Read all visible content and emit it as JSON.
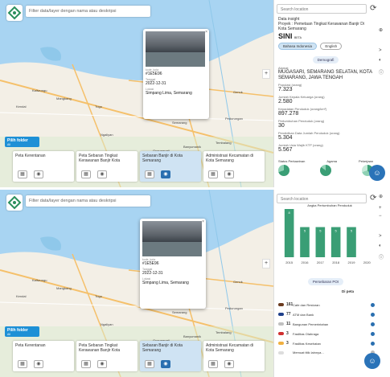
{
  "filter_placeholder": "Filter data/layer dengan nama atau deskripsi",
  "popup": {
    "code_label": "kode_kota",
    "code": "#1E5E96",
    "date_label": "Tanggal",
    "date": "2022-12-31",
    "location_label": "Lokasi",
    "location": "Simpang Lima, Semarang",
    "close": "×"
  },
  "folder": {
    "title": "Pilih folder",
    "sub": "All"
  },
  "layers": [
    {
      "name": "Peta Kerentanan"
    },
    {
      "name": "Peta Sebaran Tingkat Kerawanan Banjir Kota"
    },
    {
      "name": "Sebaran Banjir di Kota Semarang"
    },
    {
      "name": "Administrasi Kecamatan di Kota Semarang"
    }
  ],
  "map_labels": [
    "Semarang",
    "Kendal",
    "Mangkang",
    "Tugu",
    "Ngaliyan",
    "Banyumanik",
    "Tembalang",
    "Pedurungan",
    "Genuk",
    "Gunungpati",
    "Kaliwungu",
    "Bandarharjo"
  ],
  "side": {
    "search_placeholder": "Search location",
    "subtitle": "Data insight",
    "project": "Proyek : Pemetaan Tingkat Kerawanan Banjir Di Kota Semarang",
    "brand": "SINI",
    "beta": "BETA",
    "lang_id": "Bahasa Indonesia",
    "lang_en": "English",
    "section_demo": "Demografi",
    "address_label": "Alamat",
    "address": "MUGASARI, SEMARANG SELATAN, KOTA SEMARANG, JAWA TENGAH",
    "stats": [
      {
        "label": "Populasi (orang)",
        "value": "7.323"
      },
      {
        "label": "Jumlah Kepala Keluarga (orang)",
        "value": "2.580"
      },
      {
        "label": "Kepadatan Penduduk (orang/km²)",
        "value": "897.278"
      },
      {
        "label": "Pertumbuhan Penduduk (orang)",
        "value": "30"
      },
      {
        "label": "Pendidikan Data Jumlah Penduduk (orang)",
        "value": "5.304"
      },
      {
        "label": "Jumlah Usia Wajib KTP (orang)",
        "value": "5.567"
      }
    ],
    "pies": [
      "Status Perkawinan",
      "Agama",
      "Pekerjaan"
    ],
    "chart_title": "Angka Pertumbuhan Penduduk",
    "section_poi": "Persebaran POI",
    "poi_header": "Di peta",
    "poi": [
      {
        "count": "161",
        "label": "Cafe dan Restoran",
        "color": "#6b3b1f"
      },
      {
        "count": "77",
        "label": "ATM dan Bank",
        "color": "#1f3f8a"
      },
      {
        "count": "11",
        "label": "Bangunan Pemerintahan",
        "color": "#c0c0c0"
      },
      {
        "count": "3",
        "label": "Fasilitas Olahraga",
        "color": "#d03030"
      },
      {
        "count": "3",
        "label": "Fasilitas Kesehatan",
        "color": "#f0b040"
      },
      {
        "count": "",
        "label": "Memuat titik lainnya...",
        "color": "#dddddd"
      }
    ]
  },
  "chart_data": {
    "type": "bar",
    "title": "Angka Pertumbuhan Penduduk",
    "categories": [
      "2015",
      "2016",
      "2017",
      "2018",
      "2019",
      "2020"
    ],
    "values": [
      8,
      5,
      5,
      5,
      5,
      0
    ],
    "data_labels": [
      "8",
      "5",
      "5",
      "5",
      "5",
      ""
    ],
    "color": "#3a9e75"
  }
}
